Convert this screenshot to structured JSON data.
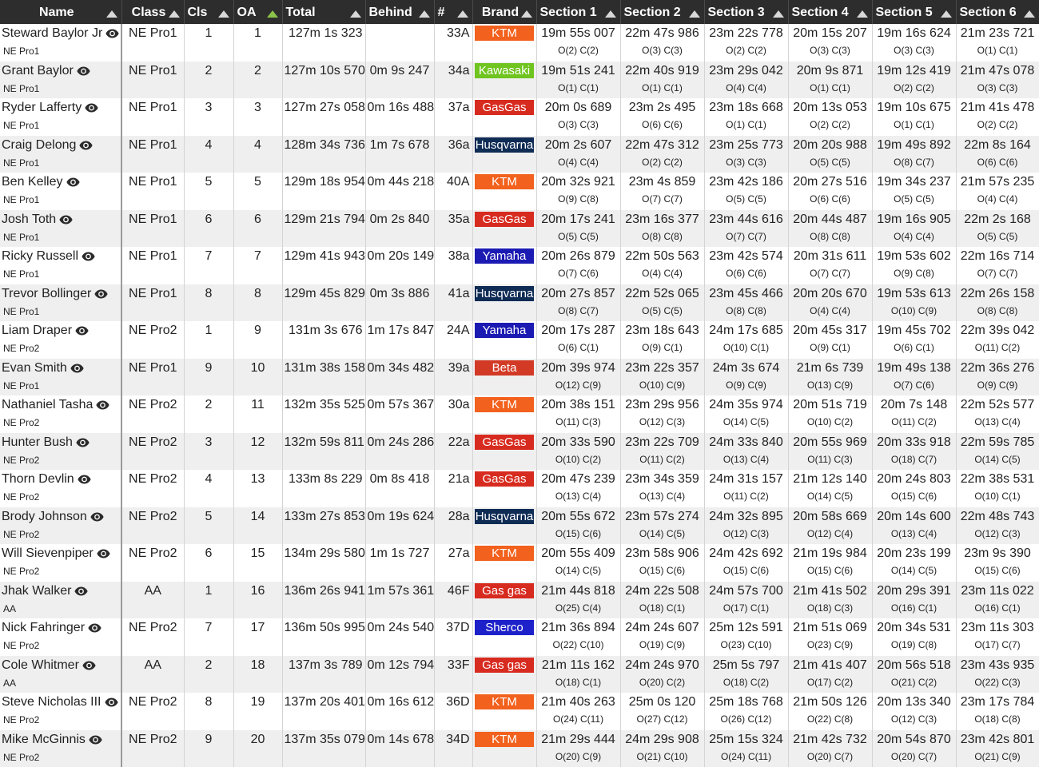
{
  "columns": [
    "Name",
    "Class",
    "Cls",
    "OA",
    "Total",
    "Behind",
    "#",
    "Brand",
    "Section 1",
    "Section 2",
    "Section 3",
    "Section 4",
    "Section 5",
    "Section 6"
  ],
  "sorted_column": "OA",
  "colors": {
    "header_bg": "#2d2d2d",
    "sort_active": "#8bc34a",
    "row_alt": "#efefef"
  },
  "brand_colors": {
    "KTM": "#f2611d",
    "Kawasaki": "#6fc41f",
    "GasGas": "#d72b1f",
    "Gas gas": "#d72b1f",
    "Husqvarna": "#0f2c55",
    "Yamaha": "#1b1bb3",
    "Beta": "#d23a26",
    "Sherco": "#1d21c9"
  },
  "rows": [
    {
      "name": "Steward Baylor Jr",
      "class": "NE Pro1",
      "cls": "1",
      "oa": "1",
      "total": "127m 1s 323",
      "behind": "",
      "number": "33A",
      "brand": "KTM",
      "sections": [
        {
          "t": "19m 55s 007",
          "p": "O(2) C(2)"
        },
        {
          "t": "22m 47s 986",
          "p": "O(3) C(3)"
        },
        {
          "t": "23m 22s 778",
          "p": "O(2) C(2)"
        },
        {
          "t": "20m 15s 207",
          "p": "O(3) C(3)"
        },
        {
          "t": "19m 16s 624",
          "p": "O(3) C(3)"
        },
        {
          "t": "21m 23s 721",
          "p": "O(1) C(1)"
        }
      ]
    },
    {
      "name": "Grant Baylor",
      "class": "NE Pro1",
      "cls": "2",
      "oa": "2",
      "total": "127m 10s 570",
      "behind": "0m 9s 247",
      "number": "34a",
      "brand": "Kawasaki",
      "sections": [
        {
          "t": "19m 51s 241",
          "p": "O(1) C(1)"
        },
        {
          "t": "22m 40s 919",
          "p": "O(1) C(1)"
        },
        {
          "t": "23m 29s 042",
          "p": "O(4) C(4)"
        },
        {
          "t": "20m 9s 871",
          "p": "O(1) C(1)"
        },
        {
          "t": "19m 12s 419",
          "p": "O(2) C(2)"
        },
        {
          "t": "21m 47s 078",
          "p": "O(3) C(3)"
        }
      ]
    },
    {
      "name": "Ryder Lafferty",
      "class": "NE Pro1",
      "cls": "3",
      "oa": "3",
      "total": "127m 27s 058",
      "behind": "0m 16s 488",
      "number": "37a",
      "brand": "GasGas",
      "sections": [
        {
          "t": "20m 0s 689",
          "p": "O(3) C(3)"
        },
        {
          "t": "23m 2s 495",
          "p": "O(6) C(6)"
        },
        {
          "t": "23m 18s 668",
          "p": "O(1) C(1)"
        },
        {
          "t": "20m 13s 053",
          "p": "O(2) C(2)"
        },
        {
          "t": "19m 10s 675",
          "p": "O(1) C(1)"
        },
        {
          "t": "21m 41s 478",
          "p": "O(2) C(2)"
        }
      ]
    },
    {
      "name": "Craig Delong",
      "class": "NE Pro1",
      "cls": "4",
      "oa": "4",
      "total": "128m 34s 736",
      "behind": "1m 7s 678",
      "number": "36a",
      "brand": "Husqvarna",
      "sections": [
        {
          "t": "20m 2s 607",
          "p": "O(4) C(4)"
        },
        {
          "t": "22m 47s 312",
          "p": "O(2) C(2)"
        },
        {
          "t": "23m 25s 773",
          "p": "O(3) C(3)"
        },
        {
          "t": "20m 20s 988",
          "p": "O(5) C(5)"
        },
        {
          "t": "19m 49s 892",
          "p": "O(8) C(7)"
        },
        {
          "t": "22m 8s 164",
          "p": "O(6) C(6)"
        }
      ]
    },
    {
      "name": "Ben Kelley",
      "class": "NE Pro1",
      "cls": "5",
      "oa": "5",
      "total": "129m 18s 954",
      "behind": "0m 44s 218",
      "number": "40A",
      "brand": "KTM",
      "sections": [
        {
          "t": "20m 32s 921",
          "p": "O(9) C(8)"
        },
        {
          "t": "23m 4s 859",
          "p": "O(7) C(7)"
        },
        {
          "t": "23m 42s 186",
          "p": "O(5) C(5)"
        },
        {
          "t": "20m 27s 516",
          "p": "O(6) C(6)"
        },
        {
          "t": "19m 34s 237",
          "p": "O(5) C(5)"
        },
        {
          "t": "21m 57s 235",
          "p": "O(4) C(4)"
        }
      ]
    },
    {
      "name": "Josh Toth",
      "class": "NE Pro1",
      "cls": "6",
      "oa": "6",
      "total": "129m 21s 794",
      "behind": "0m 2s 840",
      "number": "35a",
      "brand": "GasGas",
      "sections": [
        {
          "t": "20m 17s 241",
          "p": "O(5) C(5)"
        },
        {
          "t": "23m 16s 377",
          "p": "O(8) C(8)"
        },
        {
          "t": "23m 44s 616",
          "p": "O(7) C(7)"
        },
        {
          "t": "20m 44s 487",
          "p": "O(8) C(8)"
        },
        {
          "t": "19m 16s 905",
          "p": "O(4) C(4)"
        },
        {
          "t": "22m 2s 168",
          "p": "O(5) C(5)"
        }
      ]
    },
    {
      "name": "Ricky Russell",
      "class": "NE Pro1",
      "cls": "7",
      "oa": "7",
      "total": "129m 41s 943",
      "behind": "0m 20s 149",
      "number": "38a",
      "brand": "Yamaha",
      "sections": [
        {
          "t": "20m 26s 879",
          "p": "O(7) C(6)"
        },
        {
          "t": "22m 50s 563",
          "p": "O(4) C(4)"
        },
        {
          "t": "23m 42s 574",
          "p": "O(6) C(6)"
        },
        {
          "t": "20m 31s 611",
          "p": "O(7) C(7)"
        },
        {
          "t": "19m 53s 602",
          "p": "O(9) C(8)"
        },
        {
          "t": "22m 16s 714",
          "p": "O(7) C(7)"
        }
      ]
    },
    {
      "name": "Trevor Bollinger",
      "class": "NE Pro1",
      "cls": "8",
      "oa": "8",
      "total": "129m 45s 829",
      "behind": "0m 3s 886",
      "number": "41a",
      "brand": "Husqvarna",
      "sections": [
        {
          "t": "20m 27s 857",
          "p": "O(8) C(7)"
        },
        {
          "t": "22m 52s 065",
          "p": "O(5) C(5)"
        },
        {
          "t": "23m 45s 466",
          "p": "O(8) C(8)"
        },
        {
          "t": "20m 20s 670",
          "p": "O(4) C(4)"
        },
        {
          "t": "19m 53s 613",
          "p": "O(10) C(9)"
        },
        {
          "t": "22m 26s 158",
          "p": "O(8) C(8)"
        }
      ]
    },
    {
      "name": "Liam Draper",
      "class": "NE Pro2",
      "cls": "1",
      "oa": "9",
      "total": "131m 3s 676",
      "behind": "1m 17s 847",
      "number": "24A",
      "brand": "Yamaha",
      "sections": [
        {
          "t": "20m 17s 287",
          "p": "O(6) C(1)"
        },
        {
          "t": "23m 18s 643",
          "p": "O(9) C(1)"
        },
        {
          "t": "24m 17s 685",
          "p": "O(10) C(1)"
        },
        {
          "t": "20m 45s 317",
          "p": "O(9) C(1)"
        },
        {
          "t": "19m 45s 702",
          "p": "O(6) C(1)"
        },
        {
          "t": "22m 39s 042",
          "p": "O(11) C(2)"
        }
      ]
    },
    {
      "name": "Evan Smith",
      "class": "NE Pro1",
      "cls": "9",
      "oa": "10",
      "total": "131m 38s 158",
      "behind": "0m 34s 482",
      "number": "39a",
      "brand": "Beta",
      "sections": [
        {
          "t": "20m 39s 974",
          "p": "O(12) C(9)"
        },
        {
          "t": "23m 22s 357",
          "p": "O(10) C(9)"
        },
        {
          "t": "24m 3s 674",
          "p": "O(9) C(9)"
        },
        {
          "t": "21m 6s 739",
          "p": "O(13) C(9)"
        },
        {
          "t": "19m 49s 138",
          "p": "O(7) C(6)"
        },
        {
          "t": "22m 36s 276",
          "p": "O(9) C(9)"
        }
      ]
    },
    {
      "name": "Nathaniel Tasha",
      "class": "NE Pro2",
      "cls": "2",
      "oa": "11",
      "total": "132m 35s 525",
      "behind": "0m 57s 367",
      "number": "30a",
      "brand": "KTM",
      "sections": [
        {
          "t": "20m 38s 151",
          "p": "O(11) C(3)"
        },
        {
          "t": "23m 29s 956",
          "p": "O(12) C(3)"
        },
        {
          "t": "24m 35s 974",
          "p": "O(14) C(5)"
        },
        {
          "t": "20m 51s 719",
          "p": "O(10) C(2)"
        },
        {
          "t": "20m 7s 148",
          "p": "O(11) C(2)"
        },
        {
          "t": "22m 52s 577",
          "p": "O(13) C(4)"
        }
      ]
    },
    {
      "name": "Hunter Bush",
      "class": "NE Pro2",
      "cls": "3",
      "oa": "12",
      "total": "132m 59s 811",
      "behind": "0m 24s 286",
      "number": "22a",
      "brand": "GasGas",
      "sections": [
        {
          "t": "20m 33s 590",
          "p": "O(10) C(2)"
        },
        {
          "t": "23m 22s 709",
          "p": "O(11) C(2)"
        },
        {
          "t": "24m 33s 840",
          "p": "O(13) C(4)"
        },
        {
          "t": "20m 55s 969",
          "p": "O(11) C(3)"
        },
        {
          "t": "20m 33s 918",
          "p": "O(18) C(7)"
        },
        {
          "t": "22m 59s 785",
          "p": "O(14) C(5)"
        }
      ]
    },
    {
      "name": "Thorn Devlin",
      "class": "NE Pro2",
      "cls": "4",
      "oa": "13",
      "total": "133m 8s 229",
      "behind": "0m 8s 418",
      "number": "21a",
      "brand": "GasGas",
      "sections": [
        {
          "t": "20m 47s 239",
          "p": "O(13) C(4)"
        },
        {
          "t": "23m 34s 359",
          "p": "O(13) C(4)"
        },
        {
          "t": "24m 31s 157",
          "p": "O(11) C(2)"
        },
        {
          "t": "21m 12s 140",
          "p": "O(14) C(5)"
        },
        {
          "t": "20m 24s 803",
          "p": "O(15) C(6)"
        },
        {
          "t": "22m 38s 531",
          "p": "O(10) C(1)"
        }
      ]
    },
    {
      "name": "Brody Johnson",
      "class": "NE Pro2",
      "cls": "5",
      "oa": "14",
      "total": "133m 27s 853",
      "behind": "0m 19s 624",
      "number": "28a",
      "brand": "Husqvarna",
      "sections": [
        {
          "t": "20m 55s 672",
          "p": "O(15) C(6)"
        },
        {
          "t": "23m 57s 274",
          "p": "O(14) C(5)"
        },
        {
          "t": "24m 32s 895",
          "p": "O(12) C(3)"
        },
        {
          "t": "20m 58s 669",
          "p": "O(12) C(4)"
        },
        {
          "t": "20m 14s 600",
          "p": "O(13) C(4)"
        },
        {
          "t": "22m 48s 743",
          "p": "O(12) C(3)"
        }
      ]
    },
    {
      "name": "Will Sievenpiper",
      "class": "NE Pro2",
      "cls": "6",
      "oa": "15",
      "total": "134m 29s 580",
      "behind": "1m 1s 727",
      "number": "27a",
      "brand": "KTM",
      "sections": [
        {
          "t": "20m 55s 409",
          "p": "O(14) C(5)"
        },
        {
          "t": "23m 58s 906",
          "p": "O(15) C(6)"
        },
        {
          "t": "24m 42s 692",
          "p": "O(15) C(6)"
        },
        {
          "t": "21m 19s 984",
          "p": "O(15) C(6)"
        },
        {
          "t": "20m 23s 199",
          "p": "O(14) C(5)"
        },
        {
          "t": "23m 9s 390",
          "p": "O(15) C(6)"
        }
      ]
    },
    {
      "name": "Jhak Walker",
      "class": "AA",
      "cls": "1",
      "oa": "16",
      "total": "136m 26s 941",
      "behind": "1m 57s 361",
      "number": "46F",
      "brand": "Gas gas",
      "sections": [
        {
          "t": "21m 44s 818",
          "p": "O(25) C(4)"
        },
        {
          "t": "24m 22s 508",
          "p": "O(18) C(1)"
        },
        {
          "t": "24m 57s 700",
          "p": "O(17) C(1)"
        },
        {
          "t": "21m 41s 502",
          "p": "O(18) C(3)"
        },
        {
          "t": "20m 29s 391",
          "p": "O(16) C(1)"
        },
        {
          "t": "23m 11s 022",
          "p": "O(16) C(1)"
        }
      ]
    },
    {
      "name": "Nick Fahringer",
      "class": "NE Pro2",
      "cls": "7",
      "oa": "17",
      "total": "136m 50s 995",
      "behind": "0m 24s 540",
      "number": "37D",
      "brand": "Sherco",
      "sections": [
        {
          "t": "21m 36s 894",
          "p": "O(22) C(10)"
        },
        {
          "t": "24m 24s 607",
          "p": "O(19) C(9)"
        },
        {
          "t": "25m 12s 591",
          "p": "O(23) C(10)"
        },
        {
          "t": "21m 51s 069",
          "p": "O(23) C(9)"
        },
        {
          "t": "20m 34s 531",
          "p": "O(19) C(8)"
        },
        {
          "t": "23m 11s 303",
          "p": "O(17) C(7)"
        }
      ]
    },
    {
      "name": "Cole Whitmer",
      "class": "AA",
      "cls": "2",
      "oa": "18",
      "total": "137m 3s 789",
      "behind": "0m 12s 794",
      "number": "33F",
      "brand": "Gas gas",
      "sections": [
        {
          "t": "21m 11s 162",
          "p": "O(18) C(1)"
        },
        {
          "t": "24m 24s 970",
          "p": "O(20) C(2)"
        },
        {
          "t": "25m 5s 797",
          "p": "O(18) C(2)"
        },
        {
          "t": "21m 41s 407",
          "p": "O(17) C(2)"
        },
        {
          "t": "20m 56s 518",
          "p": "O(21) C(2)"
        },
        {
          "t": "23m 43s 935",
          "p": "O(22) C(3)"
        }
      ]
    },
    {
      "name": "Steve Nicholas III",
      "class": "NE Pro2",
      "cls": "8",
      "oa": "19",
      "total": "137m 20s 401",
      "behind": "0m 16s 612",
      "number": "36D",
      "brand": "KTM",
      "sections": [
        {
          "t": "21m 40s 263",
          "p": "O(24) C(11)"
        },
        {
          "t": "25m 0s 120",
          "p": "O(27) C(12)"
        },
        {
          "t": "25m 18s 768",
          "p": "O(26) C(12)"
        },
        {
          "t": "21m 50s 126",
          "p": "O(22) C(8)"
        },
        {
          "t": "20m 13s 340",
          "p": "O(12) C(3)"
        },
        {
          "t": "23m 17s 784",
          "p": "O(18) C(8)"
        }
      ]
    },
    {
      "name": "Mike McGinnis",
      "class": "NE Pro2",
      "cls": "9",
      "oa": "20",
      "total": "137m 35s 079",
      "behind": "0m 14s 678",
      "number": "34D",
      "brand": "KTM",
      "sections": [
        {
          "t": "21m 29s 444",
          "p": "O(20) C(9)"
        },
        {
          "t": "24m 29s 908",
          "p": "O(21) C(10)"
        },
        {
          "t": "25m 15s 324",
          "p": "O(24) C(11)"
        },
        {
          "t": "21m 42s 732",
          "p": "O(20) C(7)"
        },
        {
          "t": "20m 54s 870",
          "p": "O(20) C(7)"
        },
        {
          "t": "23m 42s 801",
          "p": "O(21) C(9)"
        }
      ]
    }
  ]
}
